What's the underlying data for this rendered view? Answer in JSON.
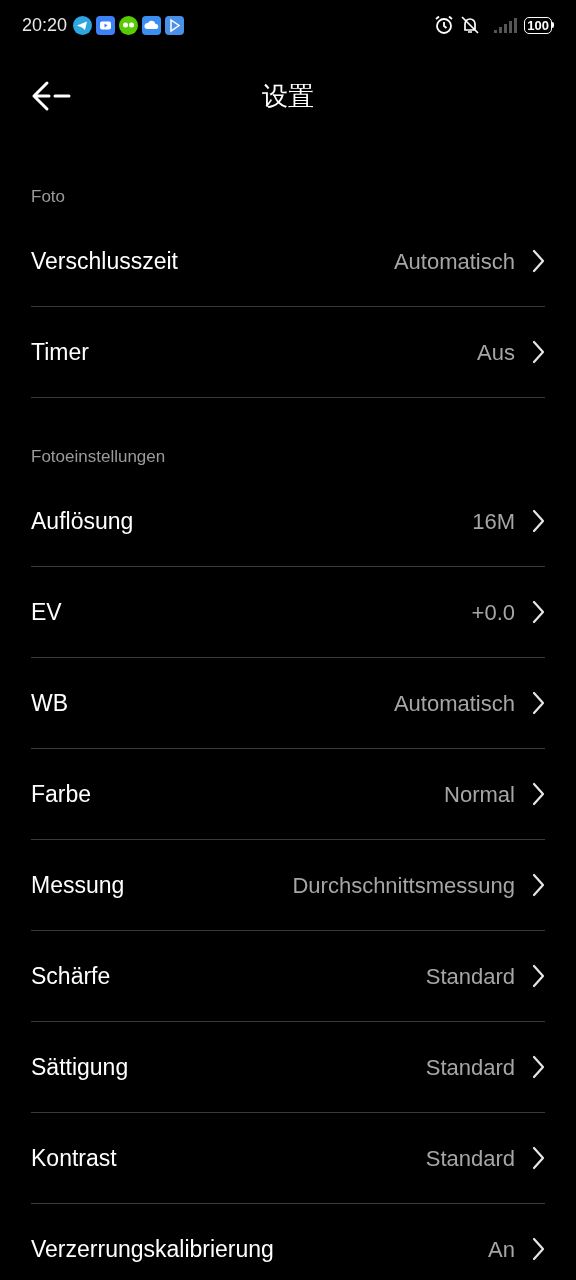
{
  "status_bar": {
    "time": "20:20",
    "battery": "100"
  },
  "header": {
    "title": "设置"
  },
  "sections": [
    {
      "title": "Foto",
      "items": [
        {
          "label": "Verschlusszeit",
          "value": "Automatisch"
        },
        {
          "label": "Timer",
          "value": "Aus"
        }
      ]
    },
    {
      "title": "Fotoeinstellungen",
      "items": [
        {
          "label": "Auflösung",
          "value": "16M"
        },
        {
          "label": "EV",
          "value": "+0.0"
        },
        {
          "label": "WB",
          "value": "Automatisch"
        },
        {
          "label": "Farbe",
          "value": "Normal"
        },
        {
          "label": "Messung",
          "value": "Durchschnittsmessung"
        },
        {
          "label": "Schärfe",
          "value": "Standard"
        },
        {
          "label": "Sättigung",
          "value": "Standard"
        },
        {
          "label": "Kontrast",
          "value": "Standard"
        },
        {
          "label": "Verzerrungskalibrierung",
          "value": "An"
        }
      ]
    }
  ]
}
